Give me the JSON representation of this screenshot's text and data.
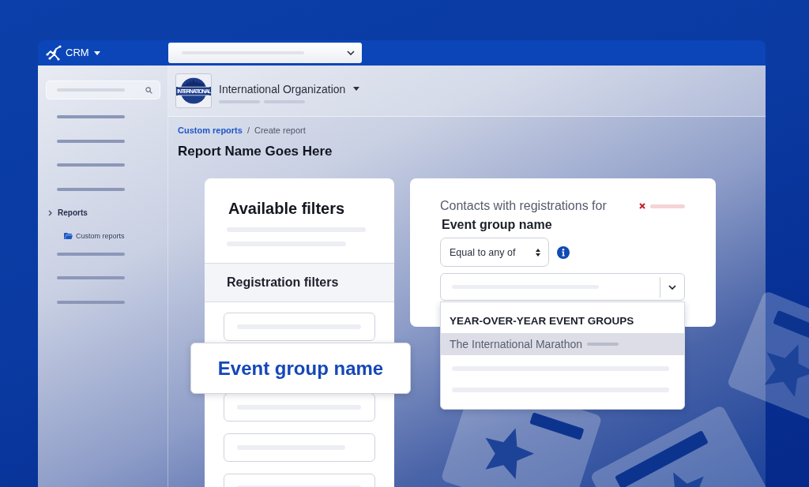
{
  "top_bar": {
    "app_name": "CRM"
  },
  "sidebar": {
    "items": [
      {
        "label": "Reports",
        "children": [
          {
            "label": "Custom reports"
          }
        ]
      }
    ]
  },
  "header": {
    "logo_text": "INTERNATIONAL",
    "organization": "International Organization"
  },
  "breadcrumb": {
    "items": [
      {
        "label": "Custom reports",
        "kind": "link"
      },
      {
        "label": "Create report",
        "kind": "current"
      }
    ],
    "separator": "/"
  },
  "page_title": "Report Name Goes Here",
  "filters_panel": {
    "title": "Available filters",
    "section": "Registration filters",
    "dragged_filter": "Event group name"
  },
  "filter_editor": {
    "prompt": "Contacts with registrations for",
    "field": "Event group name",
    "operator": "Equal to any of",
    "dropdown": {
      "group_heading": "YEAR-OVER-YEAR EVENT GROUPS",
      "options": [
        {
          "label": "The International Marathon",
          "selected": true
        }
      ]
    }
  }
}
